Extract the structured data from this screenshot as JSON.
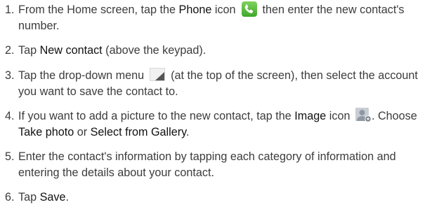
{
  "steps": [
    {
      "number": "1.",
      "parts": {
        "a": "From the Home screen, tap the ",
        "b": "Phone",
        "c": " icon ",
        "d": " then enter the new contact's number."
      }
    },
    {
      "number": "2.",
      "parts": {
        "a": "Tap ",
        "b": "New contact",
        "c": " (above the keypad)."
      }
    },
    {
      "number": "3.",
      "parts": {
        "a": "Tap the drop-down menu ",
        "b": " (at the top of the screen), then select the account you want to save the contact to."
      }
    },
    {
      "number": "4.",
      "parts": {
        "a": "If you want to add a picture to the new contact, tap the ",
        "b": "Image",
        "c": " icon ",
        "d": ". Choose ",
        "e": "Take photo",
        "f": " or ",
        "g": "Select from Gallery",
        "h": "."
      }
    },
    {
      "number": "5.",
      "parts": {
        "a": "Enter the contact's information by tapping each category of information and entering the details about your contact."
      }
    },
    {
      "number": "6.",
      "parts": {
        "a": "Tap ",
        "b": "Save",
        "c": "."
      }
    }
  ],
  "icons": {
    "phone": "phone-icon",
    "dropdown": "dropdown-menu-icon",
    "image": "contact-image-icon"
  },
  "colors": {
    "text": "#3c3c3c",
    "emphasis": "#111111",
    "phone_green": "#4cb832"
  }
}
